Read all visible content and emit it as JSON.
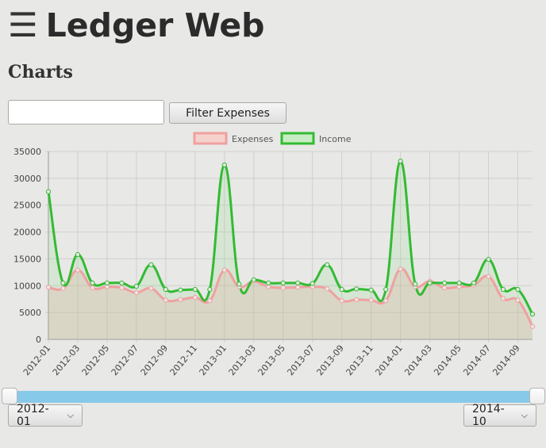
{
  "header": {
    "menu_icon": "hamburger-icon",
    "title": "Ledger Web"
  },
  "section_title": "Charts",
  "filter": {
    "input_value": "",
    "button_label": "Filter Expenses"
  },
  "chart_data": {
    "type": "line",
    "title": "",
    "xlabel": "",
    "ylabel": "",
    "x": [
      "2012-01",
      "2012-02",
      "2012-03",
      "2012-04",
      "2012-05",
      "2012-06",
      "2012-07",
      "2012-08",
      "2012-09",
      "2012-10",
      "2012-11",
      "2012-12",
      "2013-01",
      "2013-02",
      "2013-03",
      "2013-04",
      "2013-05",
      "2013-06",
      "2013-07",
      "2013-08",
      "2013-09",
      "2013-10",
      "2013-11",
      "2013-12",
      "2014-01",
      "2014-02",
      "2014-03",
      "2014-04",
      "2014-05",
      "2014-06",
      "2014-07",
      "2014-08",
      "2014-09",
      "2014-10"
    ],
    "x_tick_labels": [
      "2012-01",
      "2012-03",
      "2012-05",
      "2012-07",
      "2012-09",
      "2012-11",
      "2013-01",
      "2013-03",
      "2013-05",
      "2013-07",
      "2013-09",
      "2013-11",
      "2014-01",
      "2014-03",
      "2014-05",
      "2014-07",
      "2014-09"
    ],
    "ylim": [
      0,
      35000
    ],
    "y_ticks": [
      0,
      5000,
      10000,
      15000,
      20000,
      25000,
      30000,
      35000
    ],
    "grid": true,
    "legend_position": "top-center",
    "series": [
      {
        "name": "Expenses",
        "color": "#f0a0a0",
        "values": [
          9700,
          9500,
          12900,
          9600,
          9800,
          9600,
          8700,
          9500,
          7300,
          7400,
          7800,
          7200,
          12900,
          9800,
          10800,
          9800,
          9600,
          9700,
          9800,
          9400,
          7200,
          7400,
          7300,
          7200,
          13100,
          9800,
          10800,
          9600,
          9800,
          10100,
          11700,
          7600,
          7300,
          2400
        ]
      },
      {
        "name": "Income",
        "color": "#33bb33",
        "values": [
          27500,
          10500,
          15800,
          10500,
          10500,
          10500,
          9900,
          13900,
          9300,
          9200,
          9300,
          9300,
          32500,
          10300,
          11100,
          10500,
          10500,
          10500,
          10400,
          13900,
          9300,
          9400,
          9200,
          9300,
          33200,
          10300,
          10500,
          10500,
          10500,
          10500,
          14900,
          9300,
          9300,
          4700
        ]
      }
    ]
  },
  "range": {
    "start_label": "2012-01",
    "end_label": "2014-10"
  }
}
